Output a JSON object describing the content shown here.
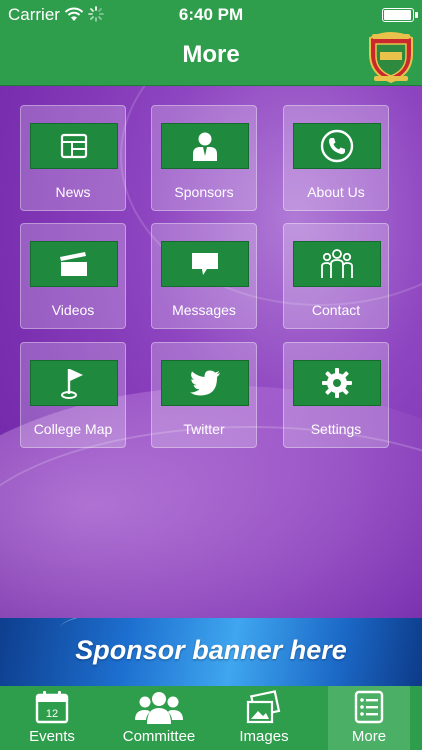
{
  "status_bar": {
    "carrier": "Carrier",
    "time": "6:40 PM",
    "battery_level": 0.95
  },
  "nav": {
    "title": "More"
  },
  "grid": [
    {
      "label": "News",
      "icon": "newspaper-icon"
    },
    {
      "label": "Sponsors",
      "icon": "person-icon"
    },
    {
      "label": "About Us",
      "icon": "phone-icon"
    },
    {
      "label": "Videos",
      "icon": "clapperboard-icon"
    },
    {
      "label": "Messages",
      "icon": "speech-bubble-icon"
    },
    {
      "label": "Contact",
      "icon": "people-group-icon"
    },
    {
      "label": "College Map",
      "icon": "golf-flag-icon"
    },
    {
      "label": "Twitter",
      "icon": "twitter-bird-icon"
    },
    {
      "label": "Settings",
      "icon": "gear-icon"
    }
  ],
  "banner": {
    "text": "Sponsor banner here"
  },
  "tabs": [
    {
      "label": "Events",
      "icon": "calendar-icon",
      "calendar_day": "12",
      "active": false
    },
    {
      "label": "Committee",
      "icon": "group-icon",
      "active": false
    },
    {
      "label": "Images",
      "icon": "photos-icon",
      "active": false
    },
    {
      "label": "More",
      "icon": "list-icon",
      "active": true
    }
  ]
}
